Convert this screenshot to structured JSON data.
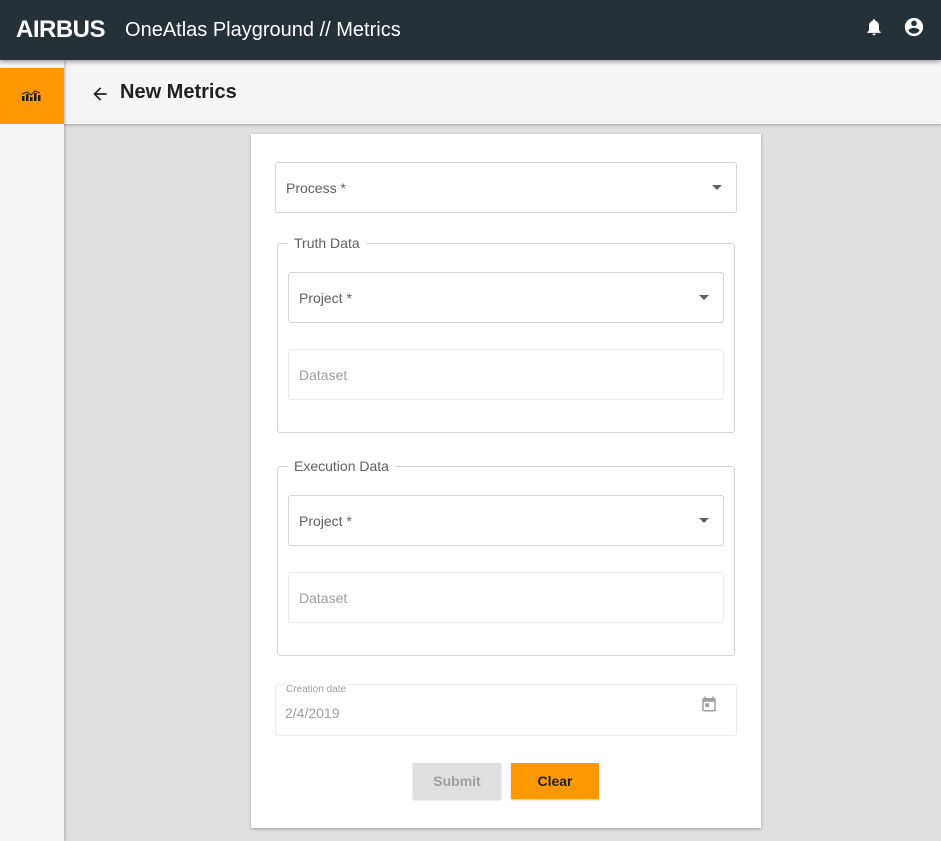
{
  "header": {
    "brand": "AIRBUS",
    "app_title": "OneAtlas Playground // Metrics",
    "icons": [
      "bell-icon",
      "account-circle-icon"
    ]
  },
  "sidebar": {
    "items": [
      {
        "icon": "metrics-chart-icon",
        "active": true
      }
    ]
  },
  "subheader": {
    "back_icon": "arrow-left-icon",
    "title": "New Metrics"
  },
  "form": {
    "process": {
      "label": "Process *"
    },
    "truth_data": {
      "legend": "Truth Data",
      "project": {
        "label": "Project *"
      },
      "dataset": {
        "placeholder": "Dataset"
      }
    },
    "execution_data": {
      "legend": "Execution Data",
      "project": {
        "label": "Project *"
      },
      "dataset": {
        "placeholder": "Dataset"
      }
    },
    "creation_date": {
      "label": "Creation date",
      "value": "2/4/2019",
      "icon": "calendar-icon"
    },
    "buttons": {
      "submit": "Submit",
      "clear": "Clear"
    }
  },
  "colors": {
    "topbar": "#253037",
    "accent": "#ff9800",
    "background": "#e0e0e0"
  }
}
